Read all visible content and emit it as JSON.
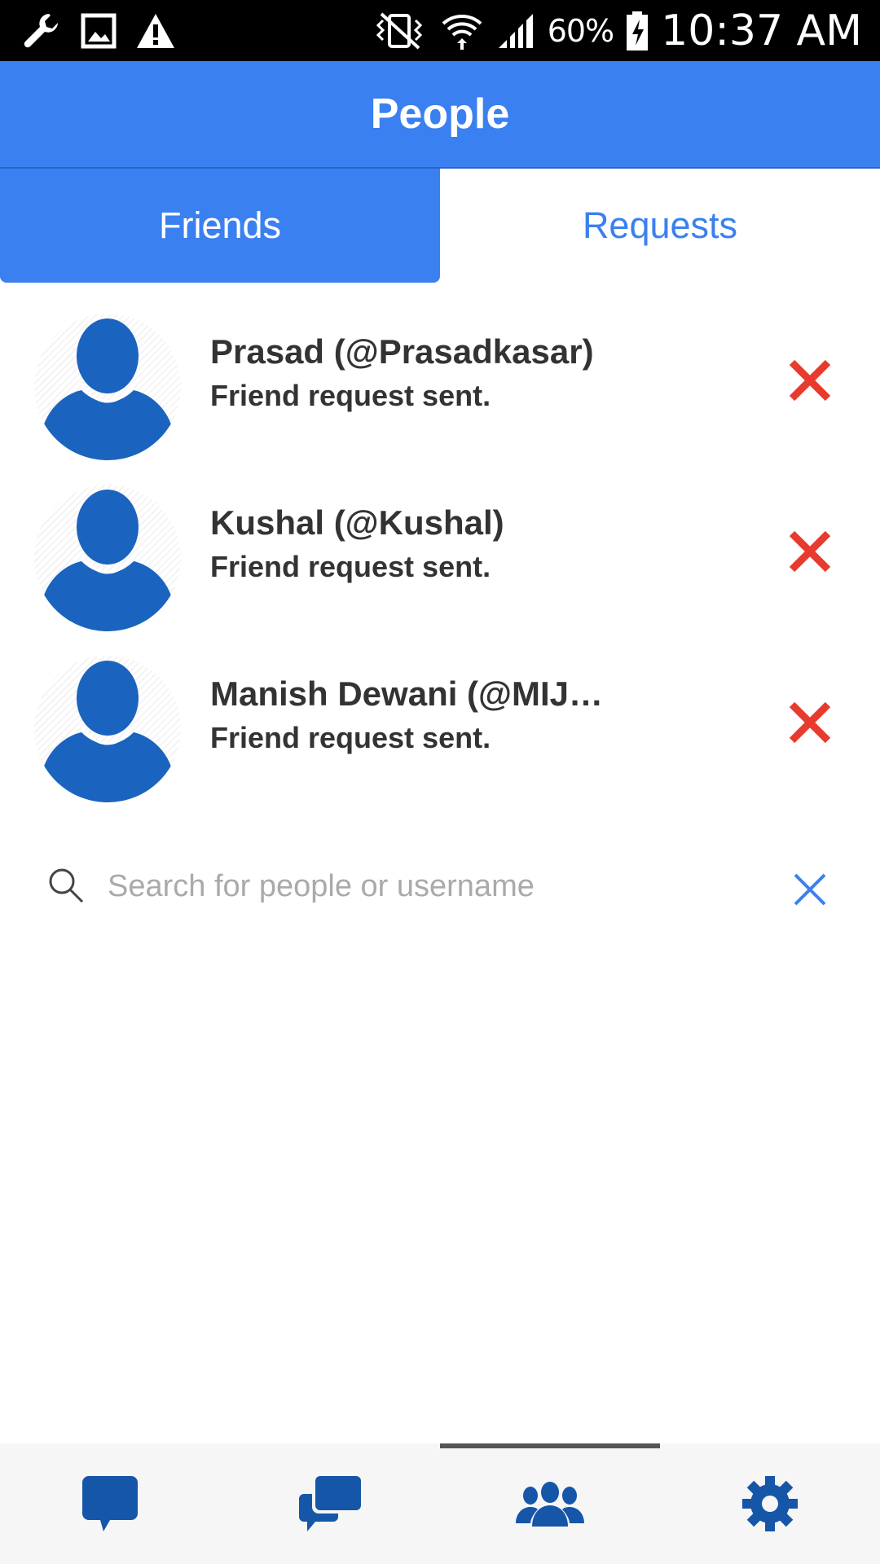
{
  "status_bar": {
    "icons_left": [
      "wrench-icon",
      "image-icon",
      "warning-icon"
    ],
    "icons_right": [
      "vibrate-icon",
      "wifi-icon",
      "signal-icon",
      "battery-charging-icon"
    ],
    "battery": "60%",
    "time": "10:37 AM"
  },
  "header": {
    "title": "People"
  },
  "tabs": [
    {
      "label": "Friends",
      "active": true
    },
    {
      "label": "Requests",
      "active": false
    }
  ],
  "requests": [
    {
      "name": "Prasad (@Prasadkasar)",
      "status": "Friend request sent."
    },
    {
      "name": "Kushal (@Kushal)",
      "status": "Friend request sent."
    },
    {
      "name": "Manish Dewani (@MIJ…",
      "status": "Friend request sent."
    }
  ],
  "search": {
    "placeholder": "Search for people or username",
    "value": ""
  },
  "bottom_nav": {
    "items": [
      "chat-icon",
      "conversations-icon",
      "people-icon",
      "settings-icon"
    ],
    "active_index": 2
  },
  "colors": {
    "primary": "#3a80f0",
    "icon_blue": "#1a63be",
    "nav_blue": "#1656a8",
    "remove_red": "#e83a2e",
    "text_dark": "#333333"
  }
}
